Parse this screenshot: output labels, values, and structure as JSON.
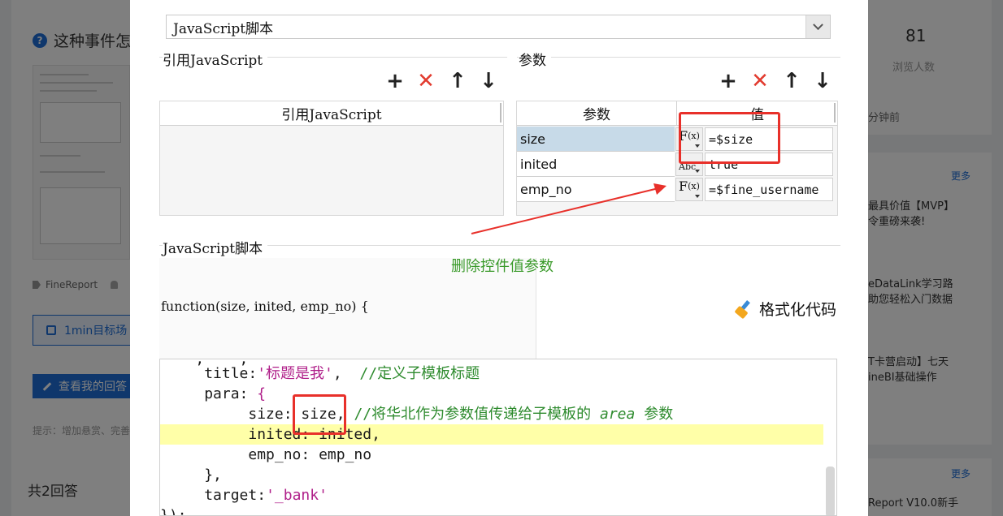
{
  "background": {
    "question_title": "这种事件怎",
    "tag": "FineReport",
    "goal_button": "1min目标场",
    "answer_button": "查看我的回答",
    "hint": "提示：增加悬赏、完善",
    "answers_count": "共2回答",
    "views_count": "81",
    "views_label": "浏览人数",
    "time_ago": "分钟前",
    "more_label": "更多",
    "news": [
      "最具价值【MVP】",
      "令重磅来袭!",
      "eDataLink学习路",
      "助您轻松入门数据",
      "T卡营启动】七天",
      "ineBI基础操作",
      "Report V10.0新手"
    ]
  },
  "dialog": {
    "type_select": "JavaScript脚本",
    "ref_section": {
      "title": "引用JavaScript",
      "column_header": "引用JavaScript"
    },
    "param_section": {
      "title": "参数",
      "col_name": "参数",
      "col_value": "值",
      "rows": [
        {
          "name": "size",
          "type_icon": "F(x)",
          "value": "=$size"
        },
        {
          "name": "inited",
          "type_icon": "Abc",
          "value": "true"
        },
        {
          "name": "emp_no",
          "type_icon": "F(x)",
          "value": "=$fine_username"
        }
      ]
    },
    "toolbar": {
      "add": "+",
      "delete": "✕",
      "up": "↑",
      "down": "↓"
    },
    "script_section": {
      "title": "JavaScript脚本",
      "signature": "function(size, inited, emp_no) {",
      "format_button": "格式化代码"
    },
    "annotation": "删除控件值参数",
    "code": {
      "line0": "    ",
      "title_key": "title",
      "title_val": "'标题是我'",
      "title_comment": "//定义子模板标题",
      "para_key": "para",
      "size_key": "size",
      "size_val": "size",
      "size_comment": "//将华北作为参数值传递给子模板的",
      "size_comment_area": "area",
      "size_comment_tail": "参数",
      "inited_line": "inited: inited,",
      "emp_line": "emp_no: emp_no",
      "close_brace": "},",
      "target_key": "target",
      "target_val": "'_bank'",
      "end_line": "});"
    }
  },
  "colors": {
    "accent": "#1e6fd9",
    "highlight_red": "#e8302a",
    "annotation_green": "#3a9a2a",
    "line_highlight": "#ffffa8"
  }
}
